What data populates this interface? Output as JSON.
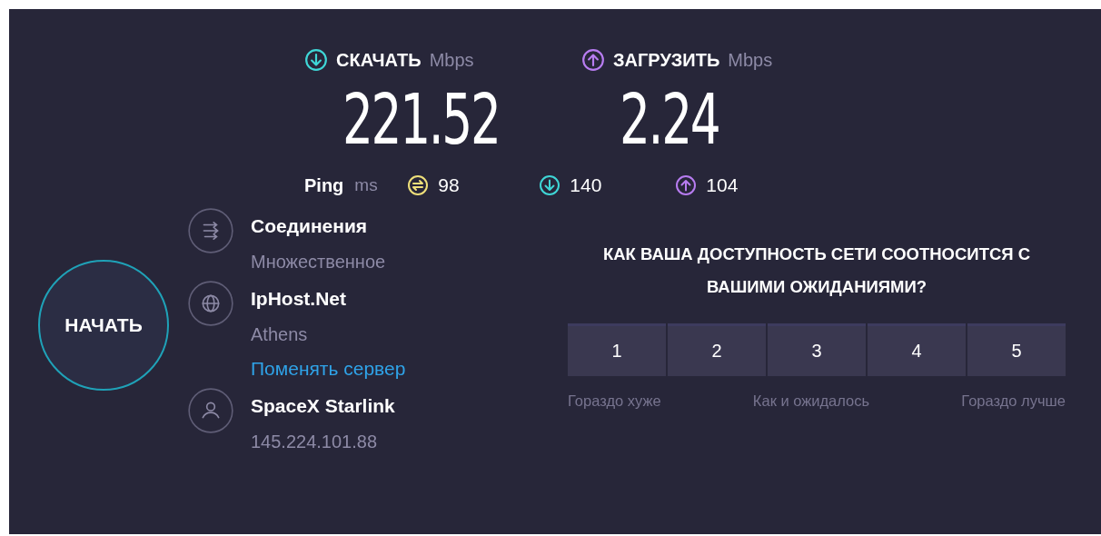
{
  "speeds": [
    {
      "kind": "download",
      "label": "СКАЧАТЬ",
      "unit": "Mbps",
      "value": "221.52",
      "color": "#3fd6d6"
    },
    {
      "kind": "upload",
      "label": "ЗАГРУЗИТЬ",
      "unit": "Mbps",
      "value": "2.24",
      "color": "#b77cf0"
    }
  ],
  "ping": {
    "label": "Ping",
    "unit": "ms",
    "stats": [
      {
        "kind": "idle",
        "value": "98",
        "color": "#efe07a"
      },
      {
        "kind": "download",
        "value": "140",
        "color": "#3fd6d6"
      },
      {
        "kind": "upload",
        "value": "104",
        "color": "#b77cf0"
      }
    ]
  },
  "start_button": "НАЧАТЬ",
  "servers": [
    {
      "kind": "connections",
      "title": "Соединения",
      "subtitle": "Множественное"
    },
    {
      "kind": "host",
      "title": "IpHost.Net",
      "subtitle": "Athens",
      "link": "Поменять сервер"
    },
    {
      "kind": "provider",
      "title": "SpaceX Starlink",
      "subtitle": "145.224.101.88"
    }
  ],
  "rating": {
    "question": "КАК ВАША ДОСТУПНОСТЬ СЕТИ СООТНОСИТСЯ С ВАШИМИ ОЖИДАНИЯМИ?",
    "options": [
      {
        "label": "1",
        "selected": false
      },
      {
        "label": "2",
        "selected": false
      },
      {
        "label": "3",
        "selected": false
      },
      {
        "label": "4",
        "selected": false
      },
      {
        "label": "5",
        "selected": false
      }
    ],
    "scale_labels": [
      "Гораздо хуже",
      "Как и ожидалось",
      "Гораздо лучше"
    ]
  }
}
